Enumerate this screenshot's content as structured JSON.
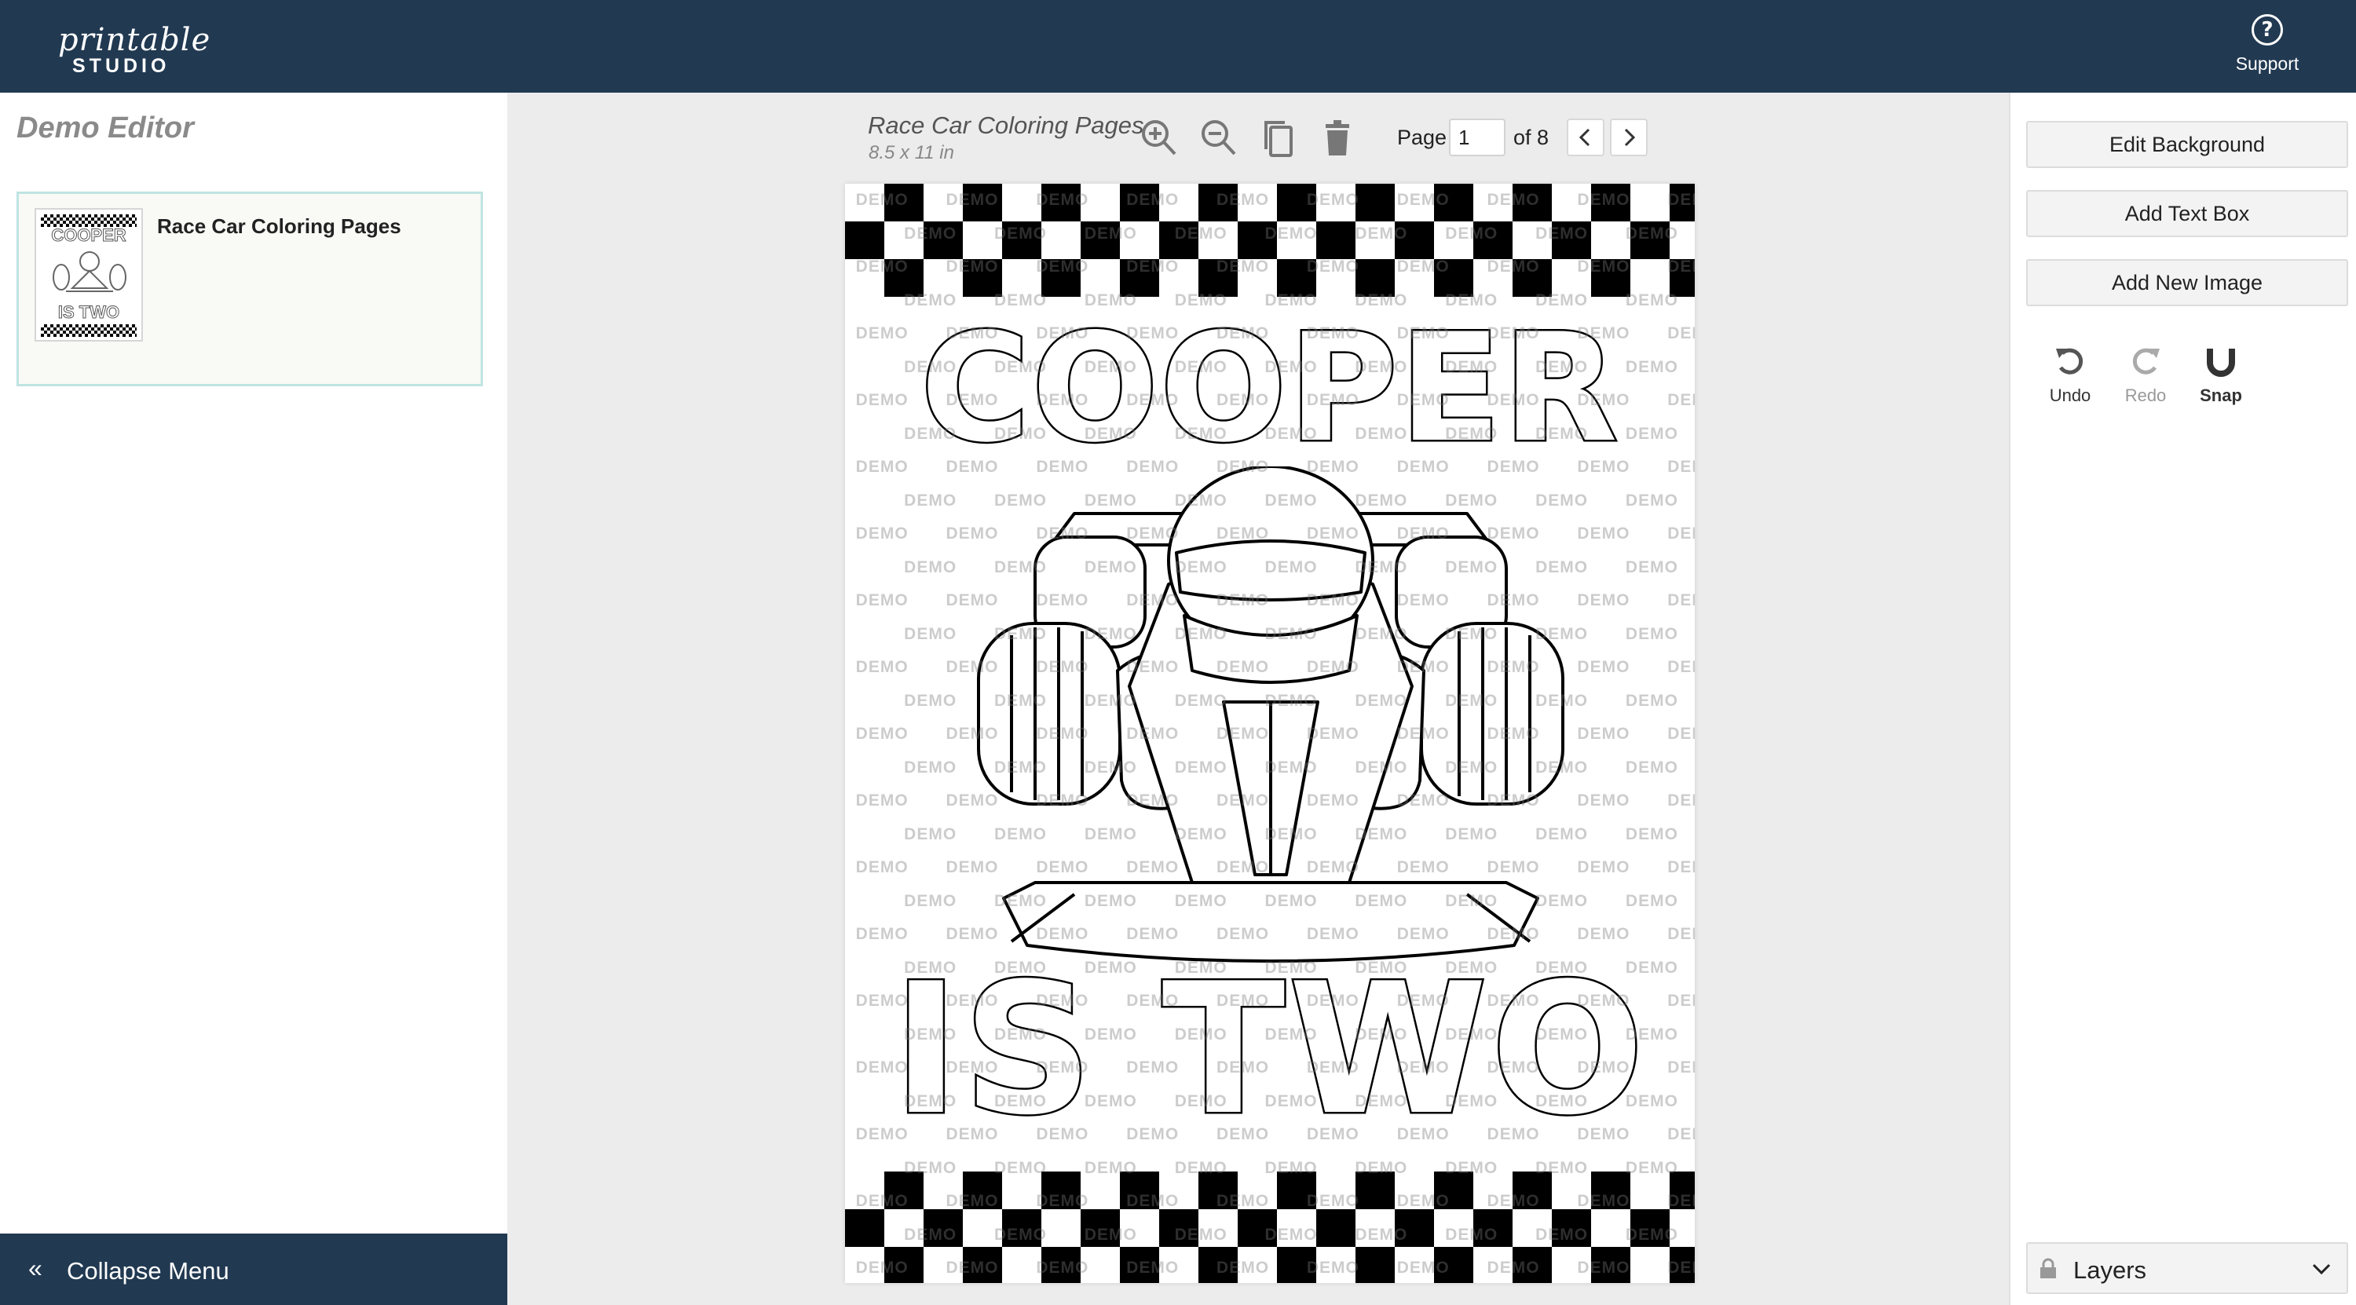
{
  "header": {
    "logo_script": "printable",
    "logo_word": "STUDIO",
    "support_label": "Support"
  },
  "sidebar": {
    "title": "Demo Editor",
    "project": {
      "name": "Race Car Coloring Pages"
    },
    "collapse_label": "Collapse Menu"
  },
  "toolbar": {
    "doc_title": "Race Car Coloring Pages",
    "doc_size": "8.5 x 11 in",
    "page_label": "Page",
    "page_value": "1",
    "page_total": "of 8",
    "icons": [
      "zoom-in-icon",
      "zoom-out-icon",
      "duplicate-icon",
      "trash-icon",
      "chevron-left-icon",
      "chevron-right-icon"
    ]
  },
  "canvas": {
    "line1": "COOPER",
    "line2": "IS TWO",
    "watermark": "DEMO"
  },
  "right_panel": {
    "buttons": [
      "Edit Background",
      "Add Text Box",
      "Add New Image"
    ],
    "undo_label": "Undo",
    "redo_label": "Redo",
    "snap_label": "Snap",
    "layers_label": "Layers"
  },
  "colors": {
    "topbar": "#213951",
    "card_border": "#bfe4e2",
    "workspace": "#ececec"
  }
}
